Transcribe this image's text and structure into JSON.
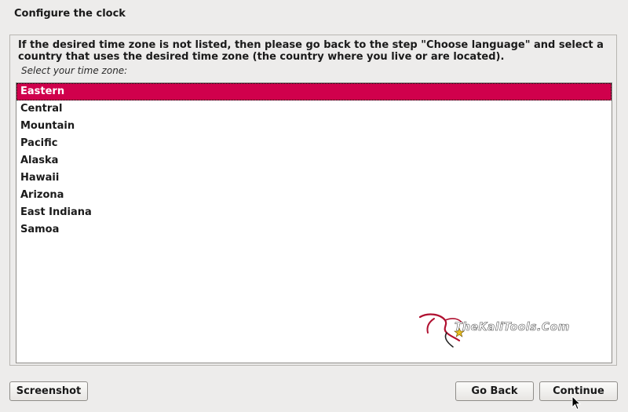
{
  "window": {
    "title": "Configure the clock"
  },
  "panel": {
    "description": "If the desired time zone is not listed, then please go back to the step \"Choose language\" and select a country that uses the desired time zone (the country where you live or are located).",
    "prompt": "Select your time zone:"
  },
  "timezones": {
    "selected": "Eastern",
    "items": [
      "Eastern",
      "Central",
      "Mountain",
      "Pacific",
      "Alaska",
      "Hawaii",
      "Arizona",
      "East Indiana",
      "Samoa"
    ]
  },
  "watermark": {
    "text": "TheKaliTools.Com"
  },
  "buttons": {
    "screenshot": "Screenshot",
    "go_back": "Go Back",
    "continue": "Continue"
  },
  "colors": {
    "selection": "#d0004c",
    "background": "#edeceb"
  }
}
